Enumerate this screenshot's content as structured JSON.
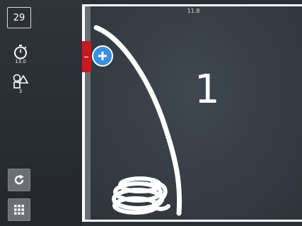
{
  "sidebar": {
    "level": "29",
    "timer": {
      "icon": "stopwatch-icon",
      "value": "13.0"
    },
    "shapes": {
      "icon": "shapes-icon",
      "value": "3"
    },
    "restart_icon": "restart-icon",
    "menu_icon": "grid-menu-icon"
  },
  "board": {
    "time_label": "11.8",
    "number": "1",
    "add_icon": "plus-icon"
  },
  "colors": {
    "background": "#2b3036",
    "board_frame": "#ffffff",
    "add_button": "#3b8fe0",
    "red_tab": "#c81820",
    "stroke": "#ffffff"
  }
}
